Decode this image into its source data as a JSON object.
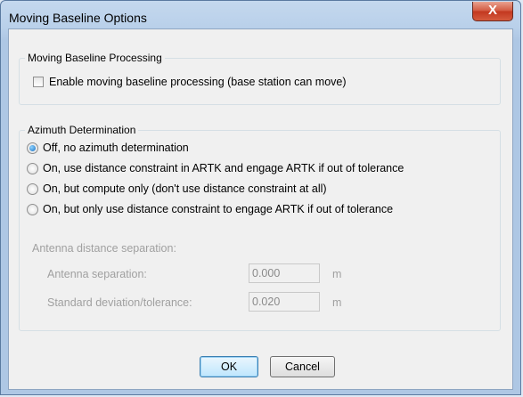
{
  "window": {
    "title": "Moving Baseline Options",
    "close_label": "X"
  },
  "moving_baseline": {
    "legend": "Moving Baseline Processing",
    "enable_label": "Enable moving baseline processing (base station can move)",
    "enable_checked": false
  },
  "azimuth": {
    "legend": "Azimuth Determination",
    "options": [
      {
        "label": "Off, no azimuth determination",
        "checked": true
      },
      {
        "label": "On, use distance constraint in ARTK and engage ARTK if out of tolerance",
        "checked": false
      },
      {
        "label": "On, but compute only (don't use distance constraint at all)",
        "checked": false
      },
      {
        "label": "On, but only use distance constraint to engage ARTK if out of tolerance",
        "checked": false
      }
    ],
    "antenna_heading": "Antenna distance separation:",
    "separation": {
      "label": "Antenna separation:",
      "value": "0.000",
      "unit": "m"
    },
    "std_dev": {
      "label": "Standard deviation/tolerance:",
      "value": "0.020",
      "unit": "m"
    }
  },
  "buttons": {
    "ok": "OK",
    "cancel": "Cancel"
  }
}
